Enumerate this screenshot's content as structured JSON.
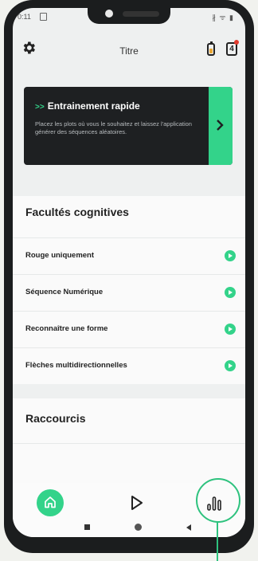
{
  "status": {
    "time": "0:11",
    "icons": "∦ ᯤ ▮"
  },
  "header": {
    "title": "Titre",
    "counter": "4",
    "settings_icon": "gear-icon",
    "battery_icon": "battery-icon"
  },
  "quick_training": {
    "title": "Entrainement rapide",
    "prefix_icon": "double-chevron-icon",
    "description": "Placez les plots où vous le souhaitez et laissez l'application générer des séquences aléatoires.",
    "arrow_icon": "chevron-right-icon"
  },
  "cognitive": {
    "title": "Facultés cognitives",
    "items": [
      {
        "label": "Rouge uniquement"
      },
      {
        "label": "Séquence Numérique"
      },
      {
        "label": "Reconnaître une forme"
      },
      {
        "label": "Flèches multidirectionnelles"
      }
    ]
  },
  "shortcuts": {
    "title": "Raccourcis"
  },
  "tabs": {
    "home_icon": "home-icon",
    "play_icon": "play-icon",
    "stats_icon": "bar-chart-icon"
  },
  "colors": {
    "accent": "#33d38a",
    "card_bg": "#1e2022",
    "notification": "#e23b2e"
  }
}
